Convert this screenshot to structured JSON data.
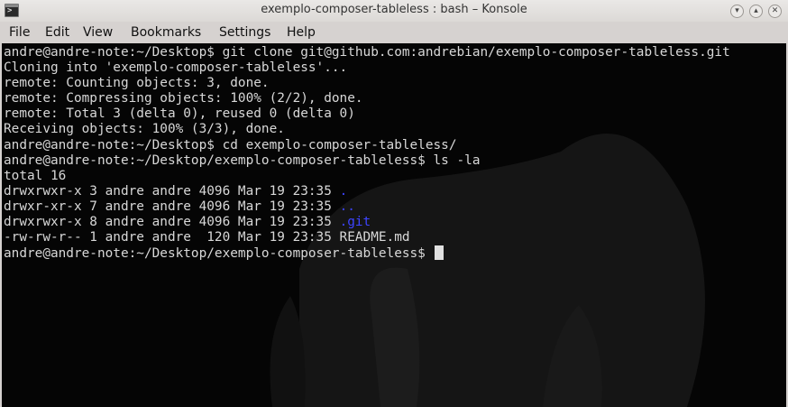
{
  "window": {
    "title": "exemplo-composer-tableless : bash – Konsole",
    "app_icon": "konsole-terminal-icon",
    "buttons": {
      "minimize": "minimize-icon",
      "maximize": "maximize-icon",
      "close": "close-icon"
    }
  },
  "menu": {
    "items": [
      "File",
      "Edit",
      "View",
      "Bookmarks",
      "Settings",
      "Help"
    ]
  },
  "terminal": {
    "colors": {
      "background": "#050505",
      "foreground": "#d8d8d8",
      "directory": "#3d44ff"
    },
    "lines": [
      {
        "text": "andre@andre-note:~/Desktop$ git clone git@github.com:andrebian/exemplo-composer-tableless.git"
      },
      {
        "text": "Cloning into 'exemplo-composer-tableless'..."
      },
      {
        "text": "remote: Counting objects: 3, done."
      },
      {
        "text": "remote: Compressing objects: 100% (2/2), done."
      },
      {
        "text": "remote: Total 3 (delta 0), reused 0 (delta 0)"
      },
      {
        "text": "Receiving objects: 100% (3/3), done."
      },
      {
        "text": "andre@andre-note:~/Desktop$ cd exemplo-composer-tableless/"
      },
      {
        "text": "andre@andre-note:~/Desktop/exemplo-composer-tableless$ ls -la"
      },
      {
        "text": "total 16"
      },
      {
        "text": "drwxrwxr-x 3 andre andre 4096 Mar 19 23:35 ",
        "name": "."
      },
      {
        "text": "drwxr-xr-x 7 andre andre 4096 Mar 19 23:35 ",
        "name": ".."
      },
      {
        "text": "drwxrwxr-x 8 andre andre 4096 Mar 19 23:35 ",
        "name": ".git"
      },
      {
        "text": "-rw-rw-r-- 1 andre andre  120 Mar 19 23:35 README.md"
      },
      {
        "text": "andre@andre-note:~/Desktop/exemplo-composer-tableless$ "
      }
    ]
  }
}
